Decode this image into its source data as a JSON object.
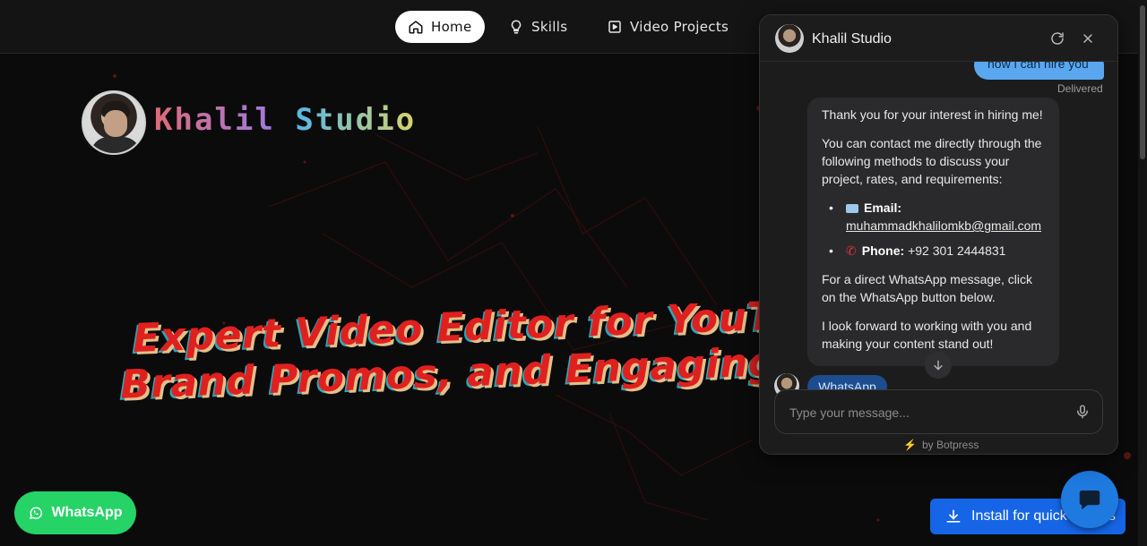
{
  "nav": {
    "items": [
      {
        "label": "Home",
        "icon": "home-icon",
        "active": true
      },
      {
        "label": "Skills",
        "icon": "lightbulb-icon",
        "active": false
      },
      {
        "label": "Video Projects",
        "icon": "play-square-icon",
        "active": false
      }
    ]
  },
  "brand": {
    "word1": "Khalil",
    "word2": "Studio"
  },
  "hero": {
    "line1": "Expert Video Editor for YouTu",
    "line2": "Brand Promos, and Engaging"
  },
  "whatsapp_float": {
    "label": "WhatsApp",
    "color": "#25d366"
  },
  "install": {
    "label": "Install for quick access",
    "color": "#1565e6"
  },
  "chat": {
    "title": "Khalil Studio",
    "user_message": "how i can hire you",
    "status": "Delivered",
    "bot": {
      "intro": "Thank you for your interest in hiring me!",
      "para1": "You can contact me directly through the following methods to discuss your project, rates, and requirements:",
      "email_label": "Email:",
      "email_value": "muhammadkhalilomkb@gmail.com",
      "phone_label": "Phone:",
      "phone_value": "+92 301 2444831",
      "para2": "For a direct WhatsApp message, click on the WhatsApp button below.",
      "para3": "I look forward to working with you and making your content stand out!"
    },
    "quick_reply": "WhatsApp",
    "input_placeholder": "Type your message...",
    "powered_by": "by Botpress",
    "accent": "#5aa7ef"
  }
}
